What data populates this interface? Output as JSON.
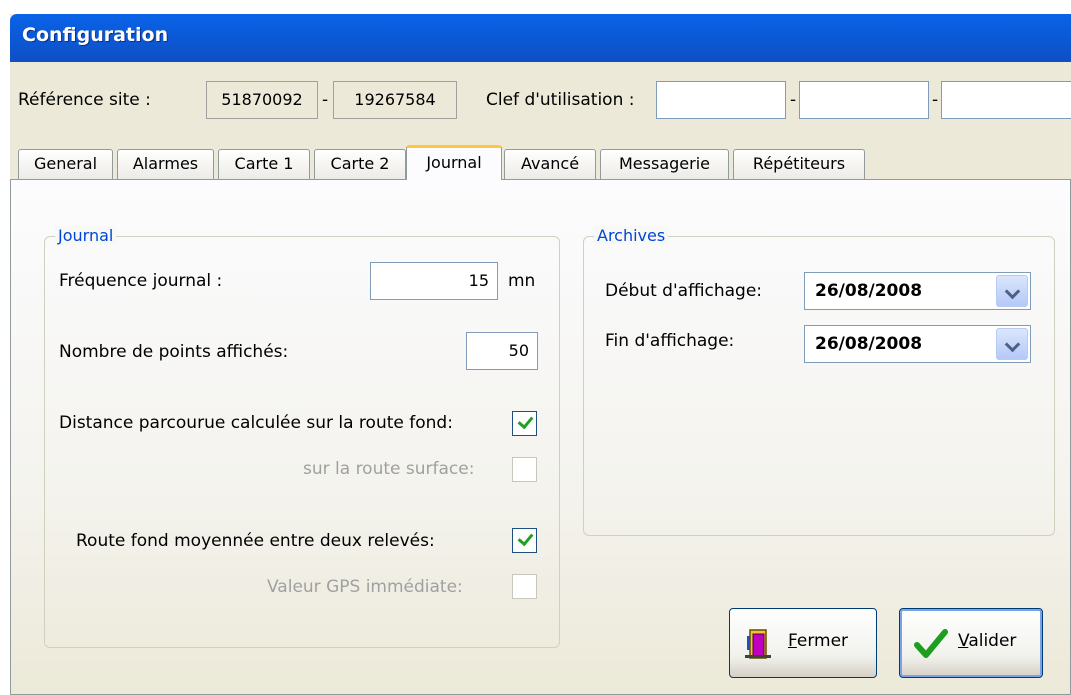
{
  "window": {
    "title": "Configuration"
  },
  "header": {
    "site_ref_label": "Référence site :",
    "site_ref_1": "51870092",
    "sep1": "-",
    "site_ref_2": "19267584",
    "key_label": "Clef d'utilisation :",
    "key_1": "",
    "sep2": "-",
    "key_2": "",
    "sep3": "-",
    "key_3": ""
  },
  "tabs": [
    "General",
    "Alarmes",
    "Carte 1",
    "Carte 2",
    "Journal",
    "Avancé",
    "Messagerie",
    "Répétiteurs"
  ],
  "active_tab": "Journal",
  "journal": {
    "legend": "Journal",
    "freq_label": "Fréquence journal :",
    "freq_value": "15",
    "freq_unit": "mn",
    "points_label": "Nombre de points affichés:",
    "points_value": "50",
    "dist_fond_label": "Distance parcourue calculée sur la route fond:",
    "dist_fond_checked": true,
    "dist_surface_label": "sur la route surface:",
    "dist_surface_checked": false,
    "route_moy_label": "Route fond moyennée entre deux relevés:",
    "route_moy_checked": true,
    "gps_label": "Valeur GPS immédiate:",
    "gps_checked": false
  },
  "archives": {
    "legend": "Archives",
    "start_label": "Début d'affichage:",
    "start_value": "26/08/2008",
    "end_label": "Fin d'affichage:",
    "end_value": "26/08/2008"
  },
  "buttons": {
    "close_hotkey": "F",
    "close_rest": "ermer",
    "validate_hotkey": "V",
    "validate_rest": "alider"
  },
  "colors": {
    "title_bar": "#0a5ad8",
    "legend": "#0046d5",
    "check": "#21a121",
    "tab_highlight": "#ffc83c"
  },
  "icons": {
    "close": "door-exit-icon",
    "validate": "green-checkmark-icon"
  }
}
